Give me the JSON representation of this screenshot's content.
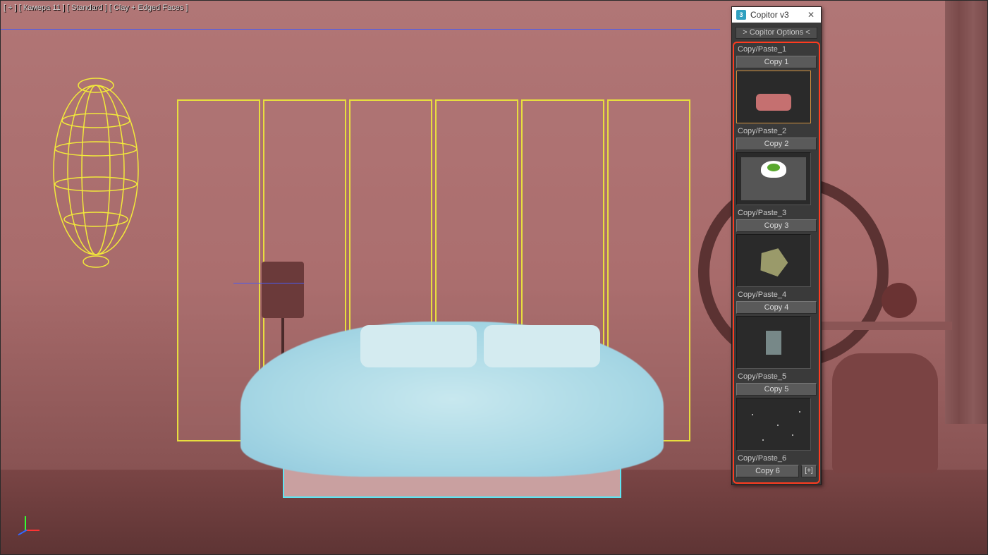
{
  "viewport": {
    "label": "[ + ] [ Камера 11 ] [ Standard ] [ Clay + Edged Faces ]"
  },
  "panel": {
    "icon_text": "3",
    "title": "Copitor v3",
    "close": "✕",
    "options_btn": "> Copitor Options <",
    "slots": [
      {
        "label": "Copy/Paste_1",
        "btn": "Copy 1",
        "thumb": "bed",
        "selected": true
      },
      {
        "label": "Copy/Paste_2",
        "btn": "Copy 2",
        "thumb": "plan"
      },
      {
        "label": "Copy/Paste_3",
        "btn": "Copy 3",
        "thumb": "geo"
      },
      {
        "label": "Copy/Paste_4",
        "btn": "Copy 4",
        "thumb": "obj"
      },
      {
        "label": "Copy/Paste_5",
        "btn": "Copy 5",
        "thumb": "dots"
      },
      {
        "label": "Copy/Paste_6",
        "btn": "Copy 6",
        "thumb": "none",
        "extra": "[+]"
      }
    ]
  }
}
